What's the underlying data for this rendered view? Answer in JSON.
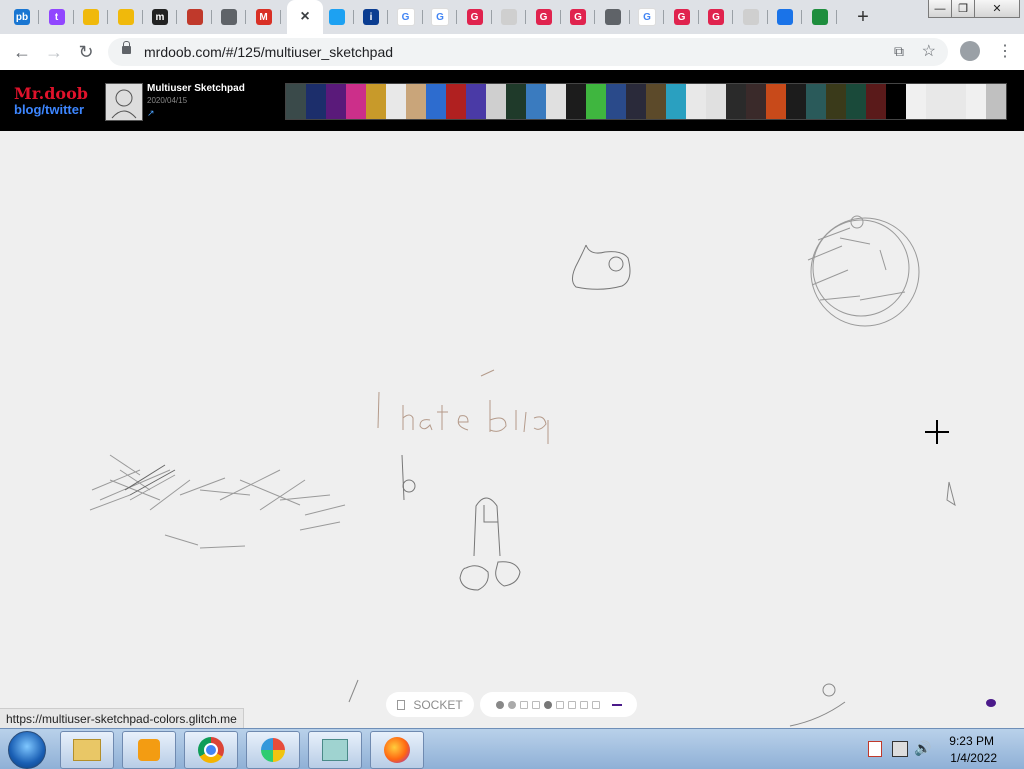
{
  "browser": {
    "tabs": [
      {
        "icon": "pdf-icon",
        "color": "#1976d2",
        "label": "pb"
      },
      {
        "icon": "twitch-icon",
        "color": "#9146ff",
        "label": "t"
      },
      {
        "icon": "binance-icon",
        "color": "#f0b90b",
        "label": ""
      },
      {
        "icon": "binance-icon",
        "color": "#f0b90b",
        "label": ""
      },
      {
        "icon": "m-icon",
        "color": "#222222",
        "label": "m"
      },
      {
        "icon": "bear-icon",
        "color": "#c0392b",
        "label": ""
      },
      {
        "icon": "globe-icon",
        "color": "#5f6368",
        "label": ""
      },
      {
        "icon": "gmail-icon",
        "color": "#d93025",
        "label": "M"
      },
      {
        "icon": "close-icon",
        "color": "#5f6368",
        "label": "×"
      },
      {
        "icon": "twitter-icon",
        "color": "#1da1f2",
        "label": ""
      },
      {
        "icon": "info-icon",
        "color": "#0b3d91",
        "label": "i"
      },
      {
        "icon": "google-icon",
        "color": "#ffffff",
        "label": "G"
      },
      {
        "icon": "google-icon",
        "color": "#ffffff",
        "label": "G"
      },
      {
        "icon": "g-red-icon",
        "color": "#e0234e",
        "label": "G"
      },
      {
        "icon": "blank-icon",
        "color": "#cfcfcf",
        "label": ""
      },
      {
        "icon": "g-red-icon",
        "color": "#e0234e",
        "label": "G"
      },
      {
        "icon": "g-red-icon",
        "color": "#e0234e",
        "label": "G"
      },
      {
        "icon": "globe-icon",
        "color": "#5f6368",
        "label": ""
      },
      {
        "icon": "google-icon",
        "color": "#ffffff",
        "label": "G"
      },
      {
        "icon": "g-red-icon",
        "color": "#e0234e",
        "label": "G"
      },
      {
        "icon": "g-red-icon",
        "color": "#e0234e",
        "label": "G"
      },
      {
        "icon": "blank-icon",
        "color": "#cfcfcf",
        "label": ""
      },
      {
        "icon": "cloud-icon",
        "color": "#1a73e8",
        "label": ""
      },
      {
        "icon": "sheet-icon",
        "color": "#1e8e3e",
        "label": ""
      }
    ],
    "new_tab": "+",
    "url": "mrdoob.com/#/125/multiuser_sketchpad",
    "status_url": "https://multiuser-sketchpad-colors.glitch.me"
  },
  "site": {
    "logo_name": "Mr.doob",
    "logo_links": "blog/twitter",
    "project_title": "Multiuser Sketchpad",
    "project_date": "2020/04/15",
    "project_link_icon": "external-link-icon",
    "thumb_colors": [
      "#3a4a4a",
      "#1c2e6b",
      "#5a1a7a",
      "#cc2f8a",
      "#c89a2a",
      "#e8e8e8",
      "#c9a57a",
      "#2d6ccf",
      "#b02020",
      "#4a3aa6",
      "#cfcfcf",
      "#1f3a2a",
      "#3a7bbf",
      "#e0e0e0",
      "#1c1c1c",
      "#3fb63f",
      "#2a4a8a",
      "#2a2a3a",
      "#5c4a2a",
      "#2aa0c0",
      "#e8e8e8",
      "#e0e0e0",
      "#2a2a2a",
      "#3a2a2a",
      "#c84a1a",
      "#1c1c1c",
      "#2a5a5a",
      "#3a3a1a",
      "#1a4a3a",
      "#5a1a1a",
      "#000000",
      "#f0f0f0",
      "#e8e8e8",
      "#e8e8e8",
      "#f0f0f0",
      "#c0c0c0",
      "#3a2a6a"
    ],
    "sketch_text": "I hate lolita"
  },
  "controls": {
    "socket_icon": "socket-icon",
    "socket_label": "SOCKET",
    "colors": [
      "#888888",
      "#aaaaaa",
      "#ffffff",
      "#ffffff",
      "#777777",
      "#ffffff",
      "#ffffff",
      "#ffffff",
      "#ffffff"
    ],
    "pen_color": "#4b1a8a"
  },
  "taskbar": {
    "start": "start-orb-icon",
    "apps": [
      "file-explorer-icon",
      "media-player-icon",
      "chrome-icon",
      "security-icon",
      "notepad-icon",
      "firefox-icon"
    ],
    "time": "9:23 PM",
    "date": "1/4/2022"
  }
}
